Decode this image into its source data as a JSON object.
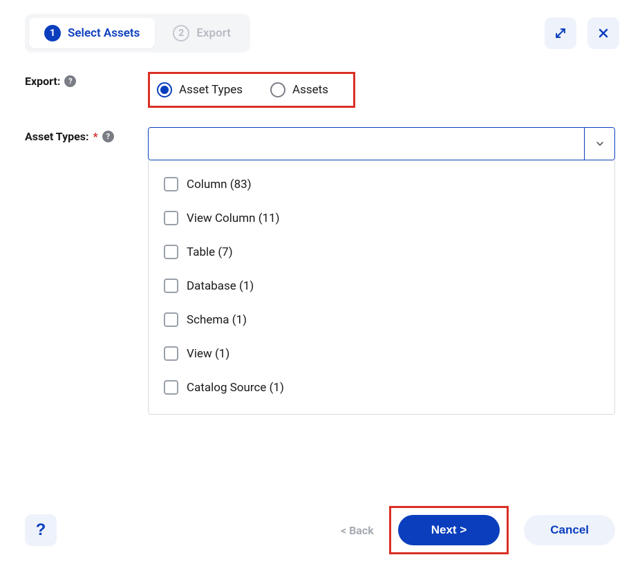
{
  "steps": {
    "items": [
      {
        "num": "1",
        "label": "Select Assets"
      },
      {
        "num": "2",
        "label": "Export"
      }
    ]
  },
  "form": {
    "export_label": "Export:",
    "radio_asset_types": "Asset Types",
    "radio_assets": "Assets",
    "asset_types_label": "Asset Types:",
    "required_mark": "*"
  },
  "asset_type_options": [
    {
      "label": "Column (83)"
    },
    {
      "label": "View Column (11)"
    },
    {
      "label": "Table (7)"
    },
    {
      "label": "Database (1)"
    },
    {
      "label": "Schema (1)"
    },
    {
      "label": "View (1)"
    },
    {
      "label": "Catalog Source (1)"
    }
  ],
  "footer": {
    "back": "< Back",
    "next": "Next >",
    "cancel": "Cancel",
    "help": "?"
  }
}
